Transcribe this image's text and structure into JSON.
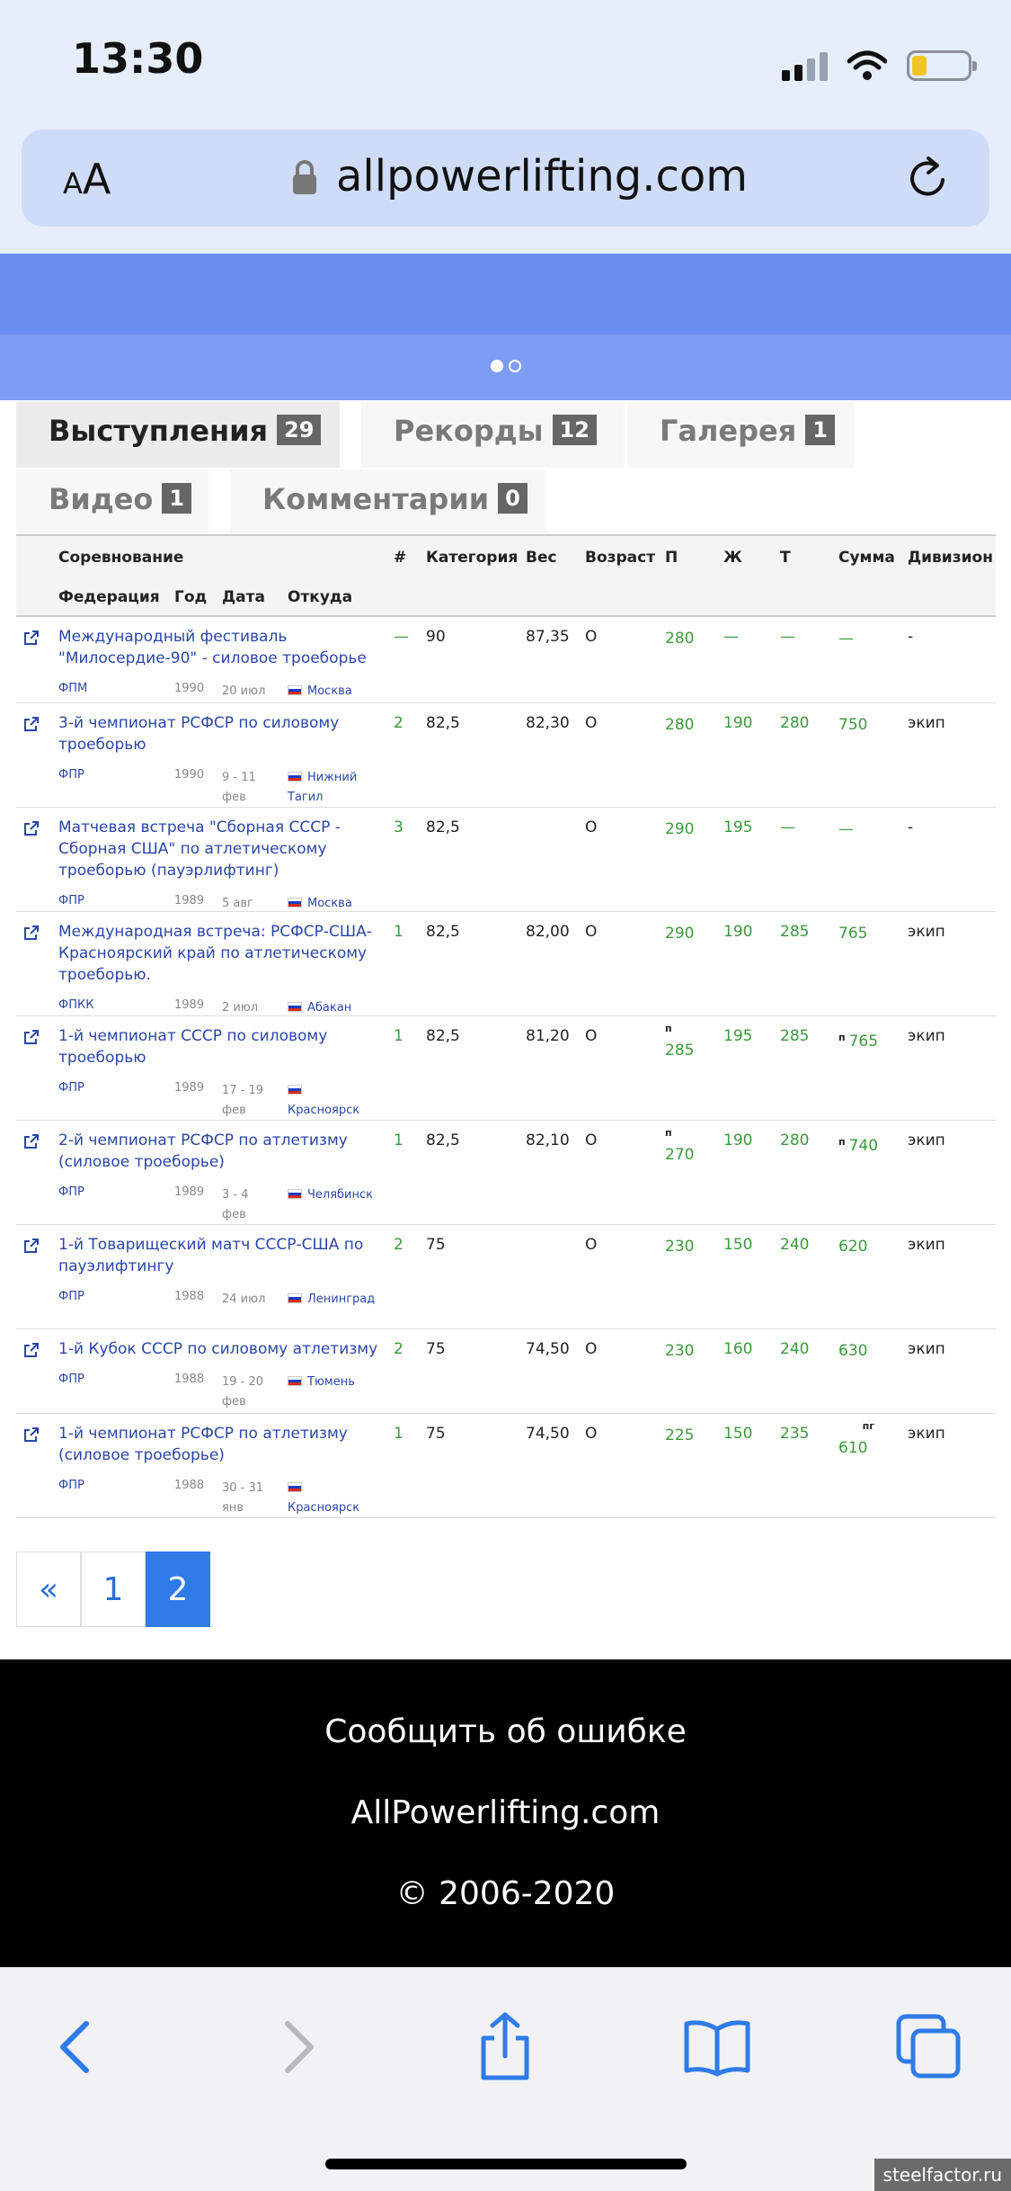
{
  "status_bar": {
    "time": "13:30"
  },
  "browser": {
    "text_size_label": "AA",
    "url": "allpowerlifting.com"
  },
  "tabs": [
    {
      "label": "Выступления",
      "count": "29"
    },
    {
      "label": "Рекорды",
      "count": "12"
    },
    {
      "label": "Галерея",
      "count": "1"
    },
    {
      "label": "Видео",
      "count": "1"
    },
    {
      "label": "Комментарии",
      "count": "0"
    }
  ],
  "table": {
    "headers": {
      "competition": "Соревнование",
      "federation": "Федерация",
      "year": "Год",
      "date": "Дата",
      "from": "Откуда",
      "place": "#",
      "category": "Категория",
      "weight": "Вес",
      "age": "Возраст",
      "squat": "П",
      "bench": "Ж",
      "deadlift": "Т",
      "total": "Сумма",
      "division": "Дивизион"
    },
    "rows": [
      {
        "comp": "Международный фестиваль \"Милосердие-90\" - силовое троеборье",
        "fed": "ФПМ",
        "year": "1990",
        "date": "20 июл",
        "city": "Москва",
        "place": "—",
        "cat": "90",
        "weight": "87,35",
        "age": "О",
        "sq_mark": "",
        "sq": "280",
        "bp": "—",
        "dl": "—",
        "total_mark": "",
        "total": "—",
        "div": "-"
      },
      {
        "comp": "3-й чемпионат РСФСР по силовому троеборью",
        "fed": "ФПР",
        "year": "1990",
        "date": "9 - 11 фев",
        "city": "Нижний Тагил",
        "place": "2",
        "cat": "82,5",
        "weight": "82,30",
        "age": "О",
        "sq_mark": "",
        "sq": "280",
        "bp": "190",
        "dl": "280",
        "total_mark": "",
        "total": "750",
        "div": "экип"
      },
      {
        "comp": "Матчевая встреча \"Сборная СССР - Сборная США\" по атлетическому троеборью (пауэрлифтинг)",
        "fed": "ФПР",
        "year": "1989",
        "date": "5 авг",
        "city": "Москва",
        "place": "3",
        "cat": "82,5",
        "weight": "",
        "age": "О",
        "sq_mark": "",
        "sq": "290",
        "bp": "195",
        "dl": "—",
        "total_mark": "",
        "total": "—",
        "div": "-"
      },
      {
        "comp": "Международная встреча: РСФСР-США-Красноярский край по атлетическому троеборью.",
        "fed": "ФПКК",
        "year": "1989",
        "date": "2 июл",
        "city": "Абакан",
        "place": "1",
        "cat": "82,5",
        "weight": "82,00",
        "age": "О",
        "sq_mark": "",
        "sq": "290",
        "bp": "190",
        "dl": "285",
        "total_mark": "",
        "total": "765",
        "div": "экип"
      },
      {
        "comp": "1-й чемпионат СССР по силовому троеборью",
        "fed": "ФПР",
        "year": "1989",
        "date": "17 - 19 фев",
        "city": "Красноярск",
        "place": "1",
        "cat": "82,5",
        "weight": "81,20",
        "age": "О",
        "sq_mark": "п",
        "sq": "285",
        "bp": "195",
        "dl": "285",
        "total_mark": "п",
        "total": "765",
        "div": "экип"
      },
      {
        "comp": "2-й чемпионат РСФСР по атлетизму (силовое троеборье)",
        "fed": "ФПР",
        "year": "1989",
        "date": "3 - 4 фев",
        "city": "Челябинск",
        "place": "1",
        "cat": "82,5",
        "weight": "82,10",
        "age": "О",
        "sq_mark": "п",
        "sq": "270",
        "bp": "190",
        "dl": "280",
        "total_mark": "п",
        "total": "740",
        "div": "экип"
      },
      {
        "comp": "1-й Товарищеский матч СССР-США по пауэлифтингу",
        "fed": "ФПР",
        "year": "1988",
        "date": "24 июл",
        "city": "Ленинград",
        "place": "2",
        "cat": "75",
        "weight": "",
        "age": "О",
        "sq_mark": "",
        "sq": "230",
        "bp": "150",
        "dl": "240",
        "total_mark": "",
        "total": "620",
        "div": "экип"
      },
      {
        "comp": "1-й Кубок СССР по силовому атлетизму",
        "fed": "ФПР",
        "year": "1988",
        "date": "19 - 20 фев",
        "city": "Тюмень",
        "place": "2",
        "cat": "75",
        "weight": "74,50",
        "age": "О",
        "sq_mark": "",
        "sq": "230",
        "bp": "160",
        "dl": "240",
        "total_mark": "",
        "total": "630",
        "div": "экип"
      },
      {
        "comp": "1-й чемпионат РСФСР по атлетизму (силовое троеборье)",
        "fed": "ФПР",
        "year": "1988",
        "date": "30 - 31 янв",
        "city": "Красноярск",
        "place": "1",
        "cat": "75",
        "weight": "74,50",
        "age": "О",
        "sq_mark": "",
        "sq": "225",
        "bp": "150",
        "dl": "235",
        "total_mark": "пг",
        "total": "610",
        "div": "экип"
      }
    ]
  },
  "pagination": {
    "prev": "«",
    "pages": [
      "1",
      "2"
    ],
    "current": "2"
  },
  "footer": {
    "report": "Сообщить об ошибке",
    "site": "AllPowerlifting.com",
    "copyright": "© 2006-2020"
  },
  "watermark": "steelfactor.ru",
  "colors": {
    "accent": "#2f7be8",
    "link": "#2a46a8",
    "result_green": "#3a9a3a",
    "banner": "#6b8ff0"
  }
}
